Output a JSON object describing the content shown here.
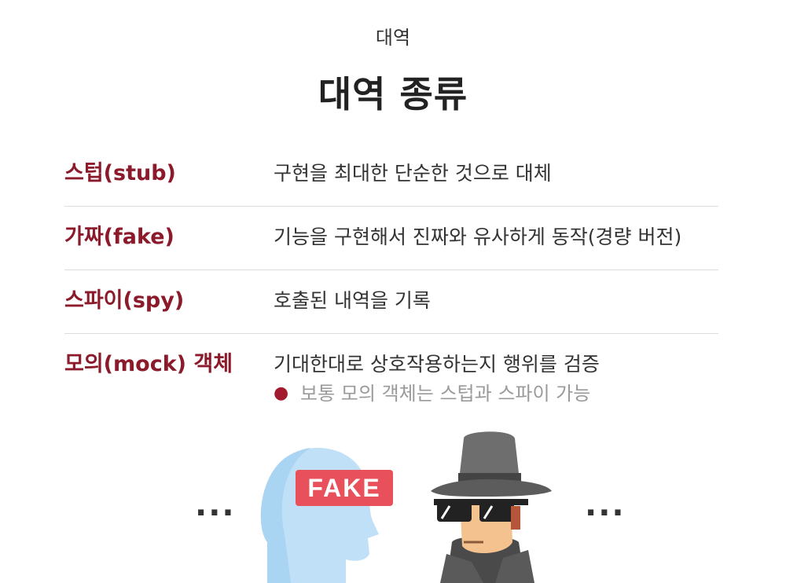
{
  "header": {
    "subtitle": "대역",
    "title": "대역 종류"
  },
  "rows": [
    {
      "term": "스텁(stub)",
      "desc": "구현을 최대한 단순한 것으로 대체"
    },
    {
      "term": "가짜(fake)",
      "desc": "기능을 구현해서 진짜와 유사하게 동작(경량 버전)"
    },
    {
      "term": "스파이(spy)",
      "desc": "호출된 내역을 기록"
    },
    {
      "term": "모의(mock) 객체",
      "desc": "기대한대로 상호작용하는지 행위를 검증",
      "bullet": "보통 모의 객체는 스텁과 스파이 가능"
    }
  ],
  "illustration": {
    "left_ellipsis": "...",
    "right_ellipsis": "...",
    "fake_label": "FAKE"
  },
  "colors": {
    "accent": "#8b1a2b",
    "fake_badge": "#e8505b",
    "head": "#bfe0f7"
  }
}
